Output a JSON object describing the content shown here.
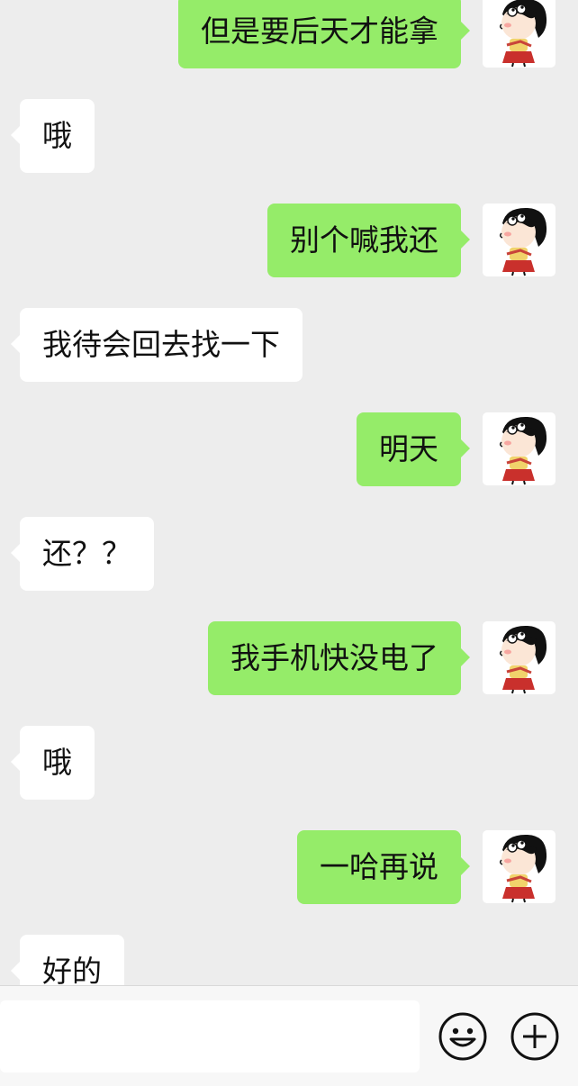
{
  "messages": [
    {
      "side": "right",
      "text": "但是要后天才能拿"
    },
    {
      "side": "left",
      "text": "哦"
    },
    {
      "side": "right",
      "text": "别个喊我还"
    },
    {
      "side": "left",
      "text": "我待会回去找一下"
    },
    {
      "side": "right",
      "text": "明天"
    },
    {
      "side": "left",
      "text": "还？？"
    },
    {
      "side": "right",
      "text": "我手机快没电了"
    },
    {
      "side": "left",
      "text": "哦"
    },
    {
      "side": "right",
      "text": "一哈再说"
    },
    {
      "side": "left",
      "text": "好的"
    }
  ],
  "input_bar": {
    "placeholder": "",
    "emoji_icon": "smiley-face-icon",
    "plus_icon": "plus-circle-icon"
  },
  "colors": {
    "chat_background": "#ededed",
    "sent_bubble": "#95ec69",
    "received_bubble": "#ffffff",
    "input_bar_background": "#f7f7f7"
  }
}
